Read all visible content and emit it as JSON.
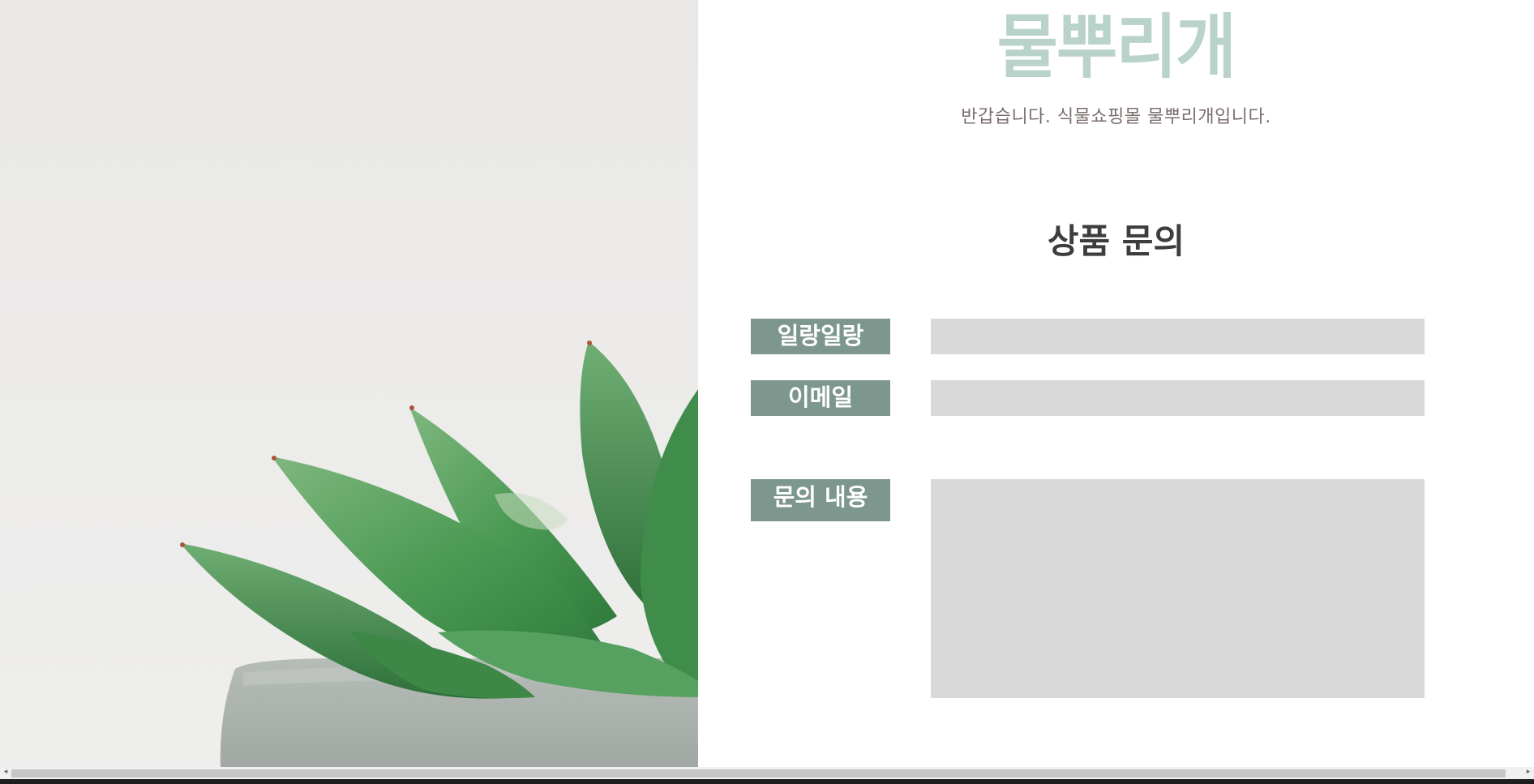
{
  "brand": {
    "logo_text": "물뿌리개",
    "greeting": "반갑습니다. 식물쇼핑몰 물뿌리개입니다.",
    "logo_color": "#b9d3c8"
  },
  "form": {
    "title": "상품 문의",
    "fields": [
      {
        "label": "일랑일랑",
        "value": ""
      },
      {
        "label": "이메일",
        "value": ""
      },
      {
        "label": "문의 내용",
        "value": ""
      }
    ],
    "label_bg": "#7e978e",
    "input_bg": "#d9d9d9"
  },
  "hero": {
    "icon": "succulent-plant-image"
  },
  "scrollbar": {
    "left_arrow": "◂",
    "right_arrow": "▸"
  }
}
